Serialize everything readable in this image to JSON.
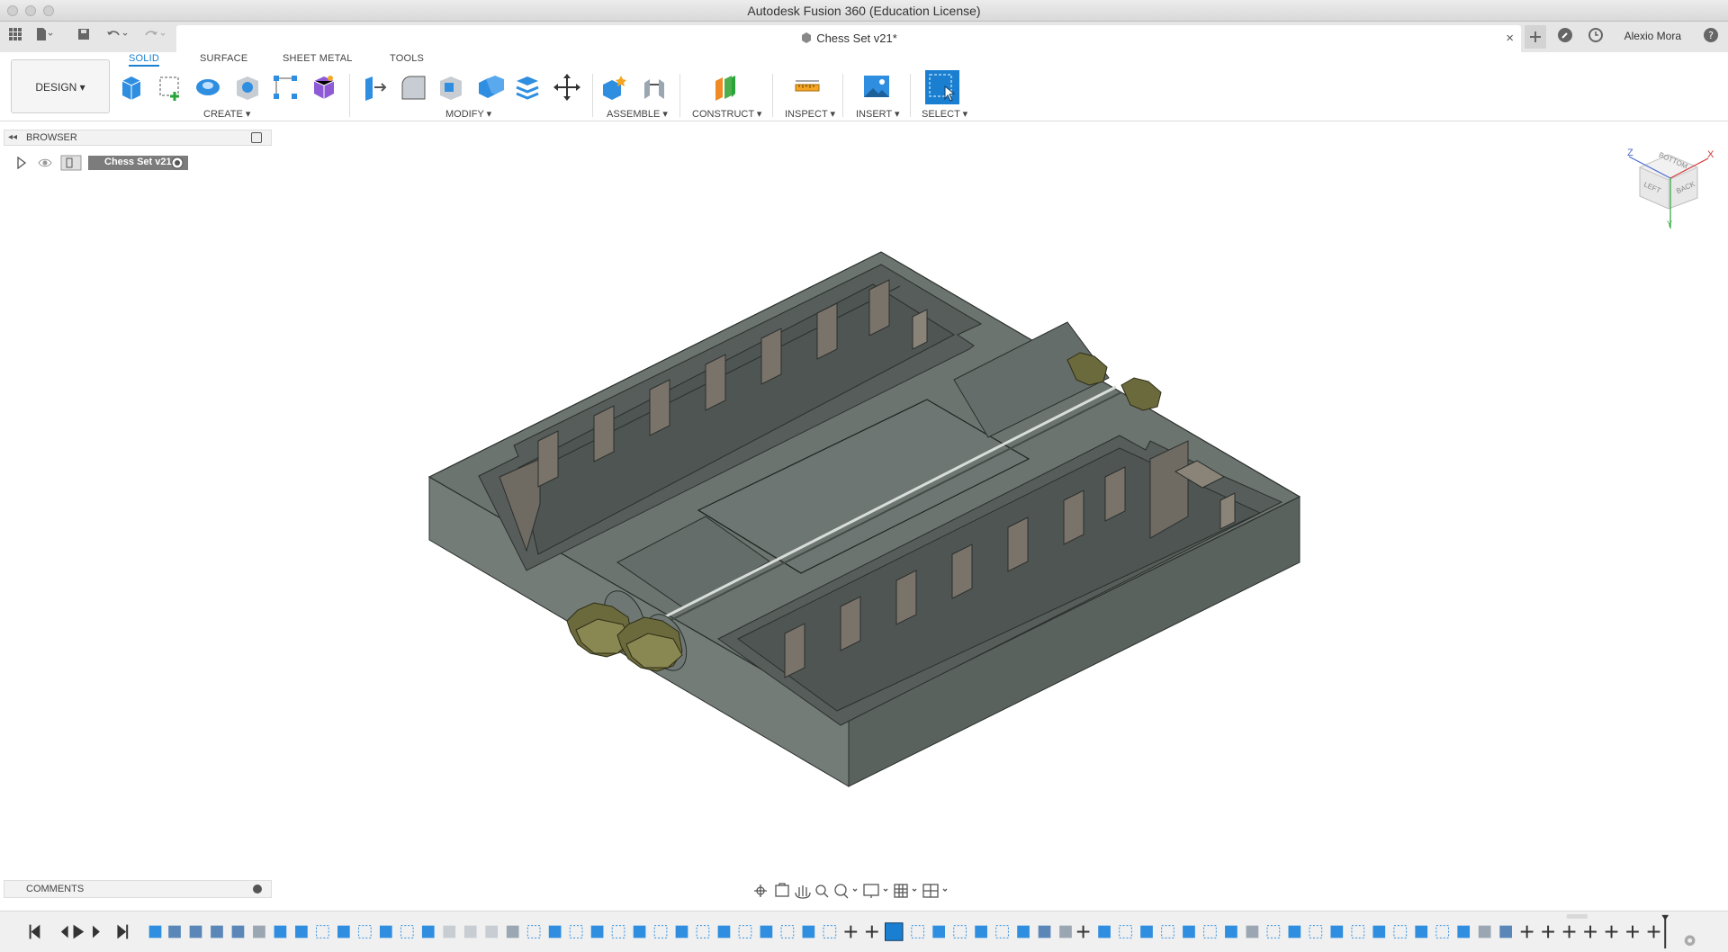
{
  "window": {
    "title": "Autodesk Fusion 360 (Education License)"
  },
  "document": {
    "tab_name": "Chess Set v21*",
    "close_glyph": "×"
  },
  "user": {
    "name": "Alexio Mora"
  },
  "toolbar": {
    "workspace_label": "DESIGN ▾",
    "tabs": [
      "SOLID",
      "SURFACE",
      "SHEET METAL",
      "TOOLS"
    ],
    "groups": {
      "create": "CREATE ▾",
      "modify": "MODIFY ▾",
      "assemble": "ASSEMBLE ▾",
      "construct": "CONSTRUCT ▾",
      "inspect": "INSPECT ▾",
      "insert": "INSERT ▾",
      "select": "SELECT ▾"
    }
  },
  "browser": {
    "title": "BROWSER",
    "root_item": "Chess Set v21"
  },
  "comments": {
    "title": "COMMENTS"
  },
  "viewcube": {
    "faces": [
      "BOTTOM",
      "LEFT",
      "BACK"
    ],
    "axes": [
      "Z",
      "X",
      "Y"
    ]
  },
  "colors": {
    "accent": "#1a7fd0",
    "body": "#6b746f",
    "insert": "#6b6a3c"
  }
}
